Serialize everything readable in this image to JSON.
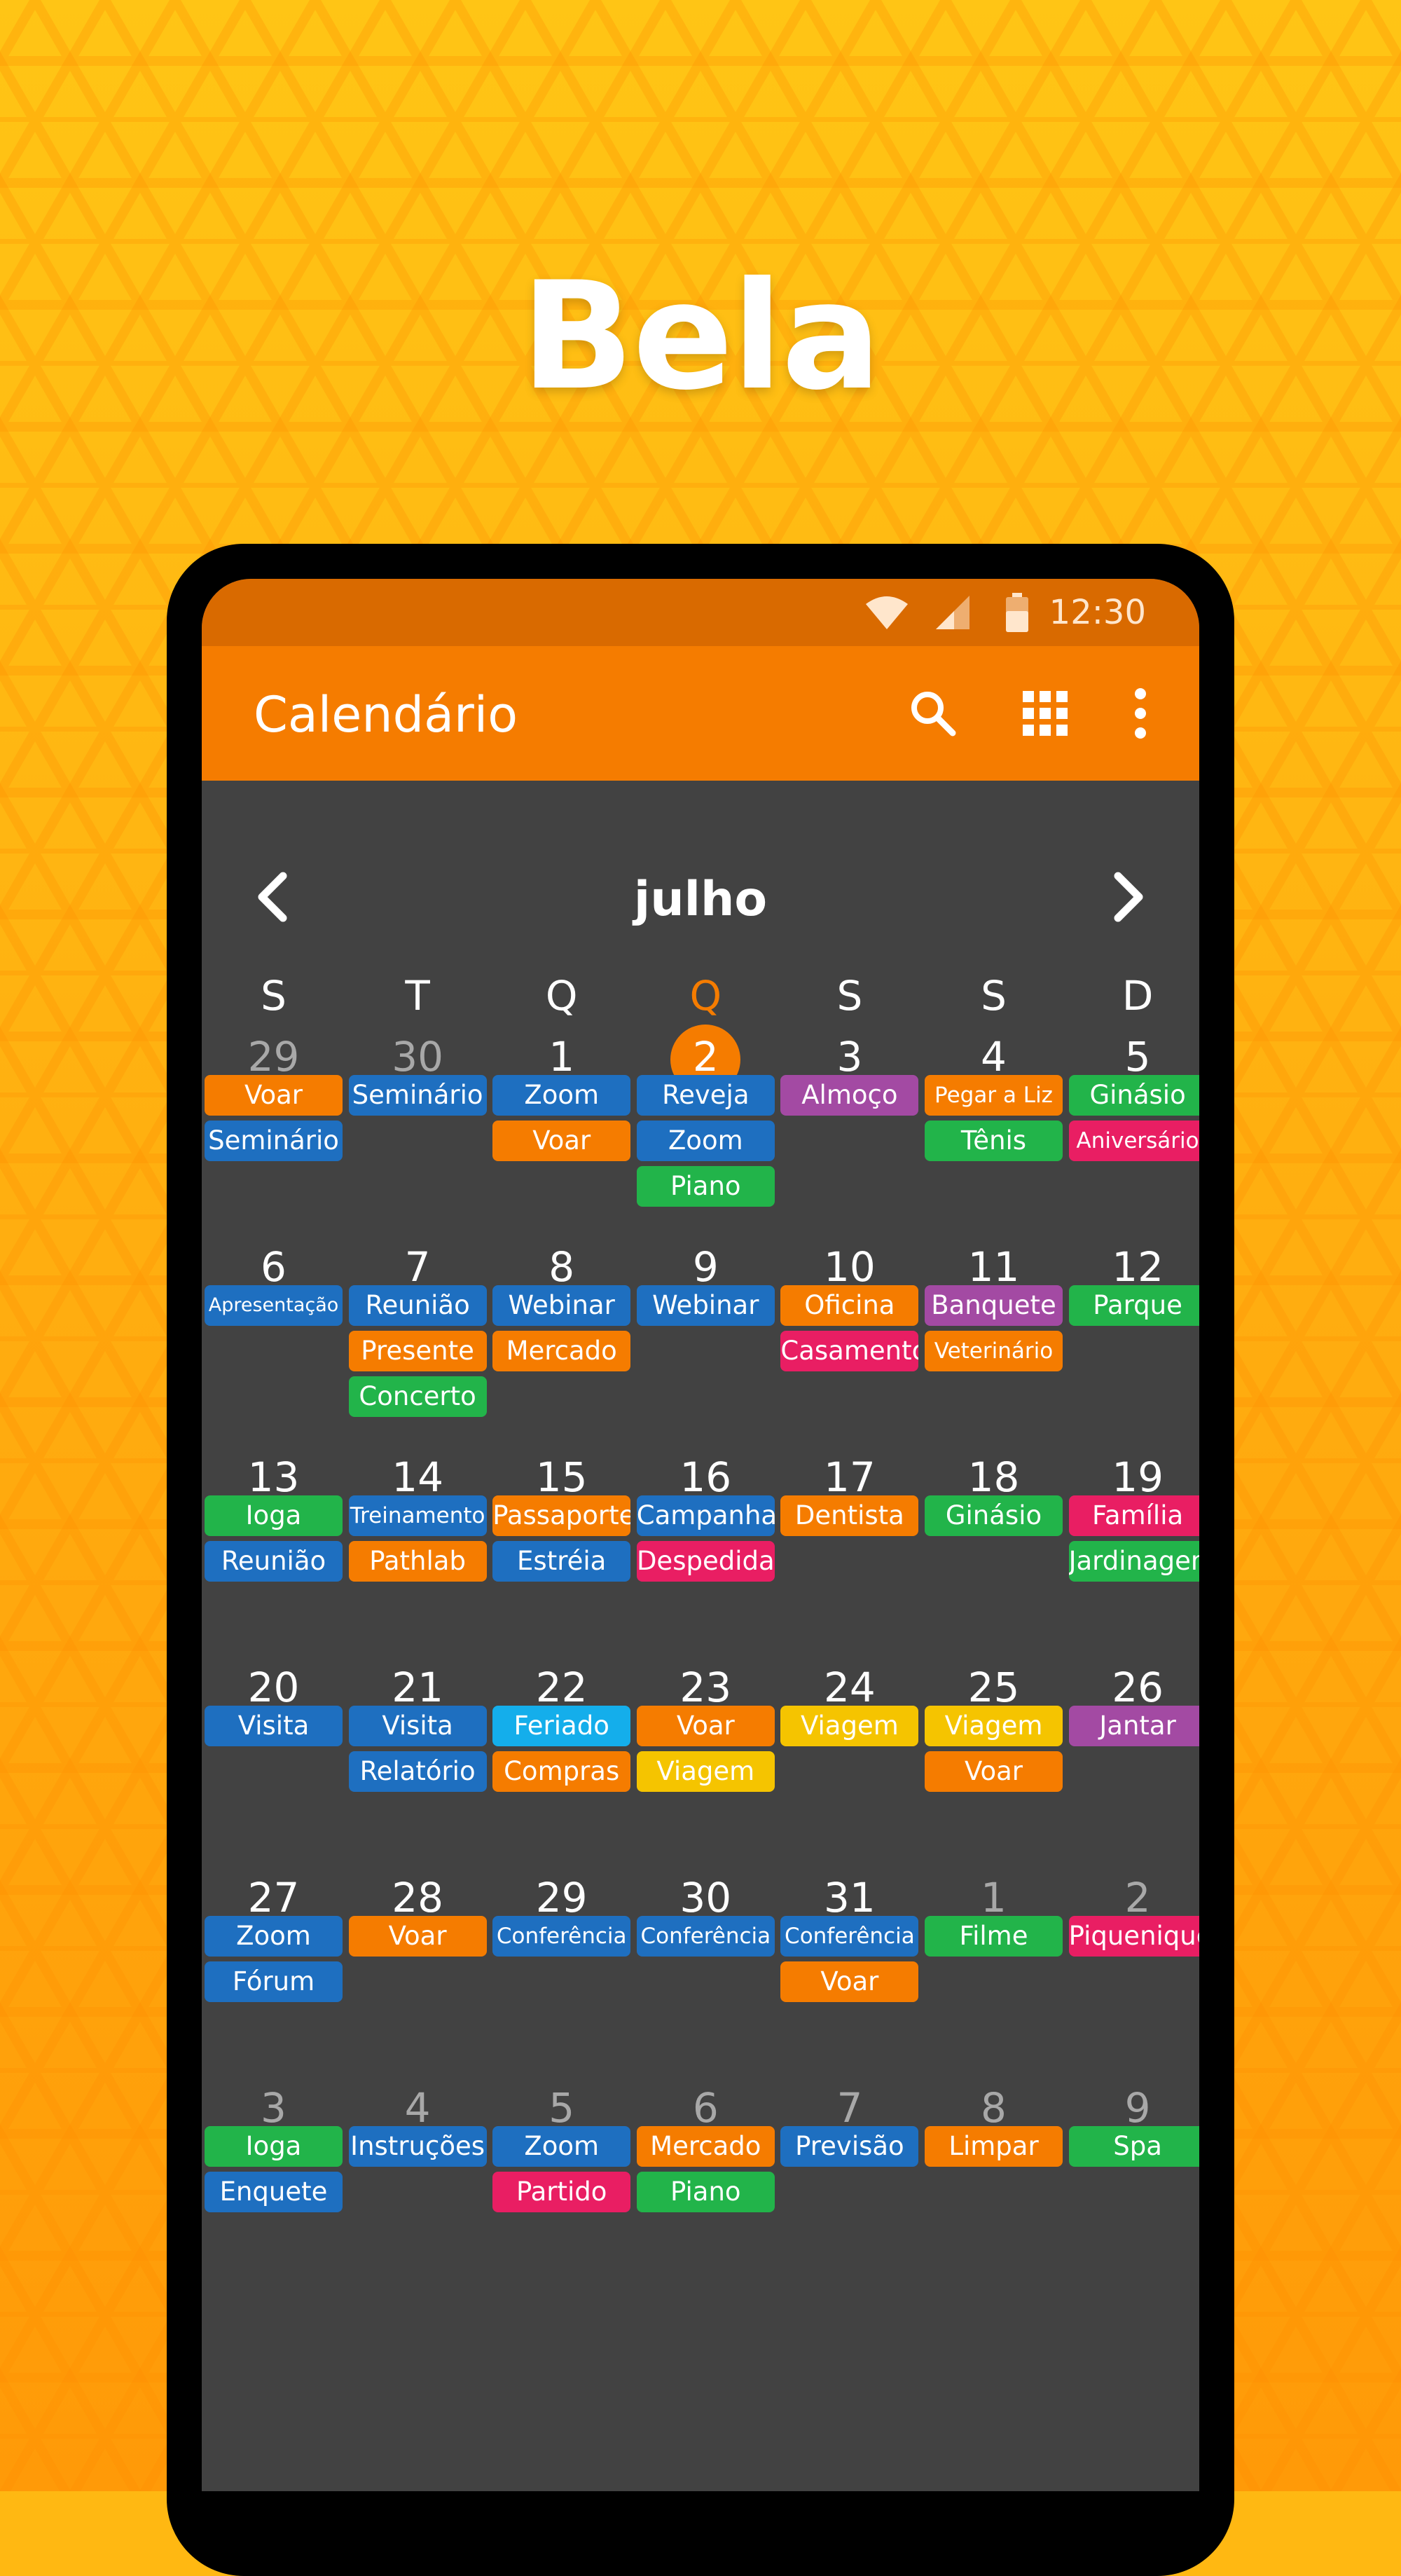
{
  "headline": "Bela",
  "status_bar": {
    "time": "12:30",
    "icons": [
      "wifi-icon",
      "signal-icon",
      "battery-icon"
    ]
  },
  "app_bar": {
    "title": "Calendário",
    "actions": [
      "search-icon",
      "grid-view-icon",
      "more-vert-icon"
    ]
  },
  "month": {
    "title": "julho",
    "prev_icon": "chevron-left-icon",
    "next_icon": "chevron-right-icon"
  },
  "weekdays": [
    "S",
    "T",
    "Q",
    "Q",
    "S",
    "S",
    "D"
  ],
  "today_column": 3,
  "colors": {
    "background": "#FFB812",
    "accent": "#F57C00",
    "status_bar": "#D96A00",
    "calendar_bg": "#424242",
    "blue": "#1E6FC0",
    "orange": "#F57C00",
    "purple": "#A34AA3",
    "green": "#22B44A",
    "pink": "#E91E63",
    "cyan": "#14AEEB",
    "yellow": "#F5C400"
  },
  "weeks": [
    {
      "days": [
        {
          "day": "29",
          "other_month": true,
          "events": [
            {
              "title": "Voar",
              "color": "orange"
            },
            {
              "title": "Seminário",
              "color": "blue"
            }
          ]
        },
        {
          "day": "30",
          "other_month": true,
          "events": [
            {
              "title": "Seminário",
              "color": "blue"
            }
          ]
        },
        {
          "day": "1",
          "events": [
            {
              "title": "Zoom",
              "color": "blue"
            },
            {
              "title": "Voar",
              "color": "orange"
            }
          ]
        },
        {
          "day": "2",
          "today": true,
          "events": [
            {
              "title": "Reveja",
              "color": "blue"
            },
            {
              "title": "Zoom",
              "color": "blue"
            },
            {
              "title": "Piano",
              "color": "green"
            }
          ]
        },
        {
          "day": "3",
          "events": [
            {
              "title": "Almoço",
              "color": "purple"
            }
          ]
        },
        {
          "day": "4",
          "events": [
            {
              "title": "Pegar a Liz",
              "color": "orange"
            },
            {
              "title": "Tênis",
              "color": "green"
            }
          ]
        },
        {
          "day": "5",
          "events": [
            {
              "title": "Ginásio",
              "color": "green"
            },
            {
              "title": "Aniversário",
              "color": "pink"
            }
          ]
        }
      ]
    },
    {
      "days": [
        {
          "day": "6",
          "events": [
            {
              "title": "Apresentação",
              "color": "blue"
            }
          ]
        },
        {
          "day": "7",
          "events": [
            {
              "title": "Reunião",
              "color": "blue"
            },
            {
              "title": "Presente",
              "color": "orange"
            },
            {
              "title": "Concerto",
              "color": "green"
            }
          ]
        },
        {
          "day": "8",
          "events": [
            {
              "title": "Webinar",
              "color": "blue"
            },
            {
              "title": "Mercado",
              "color": "orange"
            }
          ]
        },
        {
          "day": "9",
          "events": [
            {
              "title": "Webinar",
              "color": "blue"
            }
          ]
        },
        {
          "day": "10",
          "events": [
            {
              "title": "Oficina",
              "color": "orange"
            },
            {
              "title": "Casamento",
              "color": "pink"
            }
          ]
        },
        {
          "day": "11",
          "events": [
            {
              "title": "Banquete",
              "color": "purple"
            },
            {
              "title": "Veterinário",
              "color": "orange"
            }
          ]
        },
        {
          "day": "12",
          "events": [
            {
              "title": "Parque",
              "color": "green"
            }
          ]
        }
      ]
    },
    {
      "days": [
        {
          "day": "13",
          "events": [
            {
              "title": "Ioga",
              "color": "green"
            },
            {
              "title": "Reunião",
              "color": "blue"
            }
          ]
        },
        {
          "day": "14",
          "events": [
            {
              "title": "Treinamento",
              "color": "blue"
            },
            {
              "title": "Pathlab",
              "color": "orange"
            }
          ]
        },
        {
          "day": "15",
          "events": [
            {
              "title": "Passaporte",
              "color": "orange"
            },
            {
              "title": "Estréia",
              "color": "blue"
            }
          ]
        },
        {
          "day": "16",
          "events": [
            {
              "title": "Campanha",
              "color": "blue"
            },
            {
              "title": "Despedida",
              "color": "pink"
            }
          ]
        },
        {
          "day": "17",
          "events": [
            {
              "title": "Dentista",
              "color": "orange"
            }
          ]
        },
        {
          "day": "18",
          "events": [
            {
              "title": "Ginásio",
              "color": "green"
            }
          ]
        },
        {
          "day": "19",
          "events": [
            {
              "title": "Família",
              "color": "pink"
            },
            {
              "title": "Jardinagem",
              "color": "green"
            }
          ]
        }
      ]
    },
    {
      "days": [
        {
          "day": "20",
          "events": [
            {
              "title": "Visita",
              "color": "blue"
            }
          ]
        },
        {
          "day": "21",
          "events": [
            {
              "title": "Visita",
              "color": "blue"
            },
            {
              "title": "Relatório",
              "color": "blue"
            }
          ]
        },
        {
          "day": "22",
          "events": [
            {
              "title": "Feriado",
              "color": "cyan"
            },
            {
              "title": "Compras",
              "color": "orange"
            }
          ]
        },
        {
          "day": "23",
          "events": [
            {
              "title": "Voar",
              "color": "orange"
            },
            {
              "title": "Viagem",
              "color": "yellow"
            }
          ]
        },
        {
          "day": "24",
          "events": [
            {
              "title": "Viagem",
              "color": "yellow"
            }
          ]
        },
        {
          "day": "25",
          "events": [
            {
              "title": "Viagem",
              "color": "yellow"
            },
            {
              "title": "Voar",
              "color": "orange"
            }
          ]
        },
        {
          "day": "26",
          "events": [
            {
              "title": "Jantar",
              "color": "purple"
            }
          ]
        }
      ]
    },
    {
      "days": [
        {
          "day": "27",
          "events": [
            {
              "title": "Zoom",
              "color": "blue"
            },
            {
              "title": "Fórum",
              "color": "blue"
            }
          ]
        },
        {
          "day": "28",
          "events": [
            {
              "title": "Voar",
              "color": "orange"
            }
          ]
        },
        {
          "day": "29",
          "events": [
            {
              "title": "Conferência",
              "color": "blue"
            }
          ]
        },
        {
          "day": "30",
          "events": [
            {
              "title": "Conferência",
              "color": "blue"
            }
          ]
        },
        {
          "day": "31",
          "events": [
            {
              "title": "Conferência",
              "color": "blue"
            },
            {
              "title": "Voar",
              "color": "orange"
            }
          ]
        },
        {
          "day": "1",
          "other_month": true,
          "events": [
            {
              "title": "Filme",
              "color": "green"
            }
          ]
        },
        {
          "day": "2",
          "other_month": true,
          "events": [
            {
              "title": "Piquenique",
              "color": "pink"
            }
          ]
        }
      ]
    },
    {
      "days": [
        {
          "day": "3",
          "other_month": true,
          "events": [
            {
              "title": "Ioga",
              "color": "green"
            },
            {
              "title": "Enquete",
              "color": "blue"
            }
          ]
        },
        {
          "day": "4",
          "other_month": true,
          "events": [
            {
              "title": "Instruções",
              "color": "blue"
            }
          ]
        },
        {
          "day": "5",
          "other_month": true,
          "events": [
            {
              "title": "Zoom",
              "color": "blue"
            },
            {
              "title": "Partido",
              "color": "pink"
            }
          ]
        },
        {
          "day": "6",
          "other_month": true,
          "events": [
            {
              "title": "Mercado",
              "color": "orange"
            },
            {
              "title": "Piano",
              "color": "green"
            }
          ]
        },
        {
          "day": "7",
          "other_month": true,
          "events": [
            {
              "title": "Previsão",
              "color": "blue"
            }
          ]
        },
        {
          "day": "8",
          "other_month": true,
          "events": [
            {
              "title": "Limpar",
              "color": "orange"
            }
          ]
        },
        {
          "day": "9",
          "other_month": true,
          "events": [
            {
              "title": "Spa",
              "color": "green"
            }
          ]
        }
      ]
    }
  ]
}
